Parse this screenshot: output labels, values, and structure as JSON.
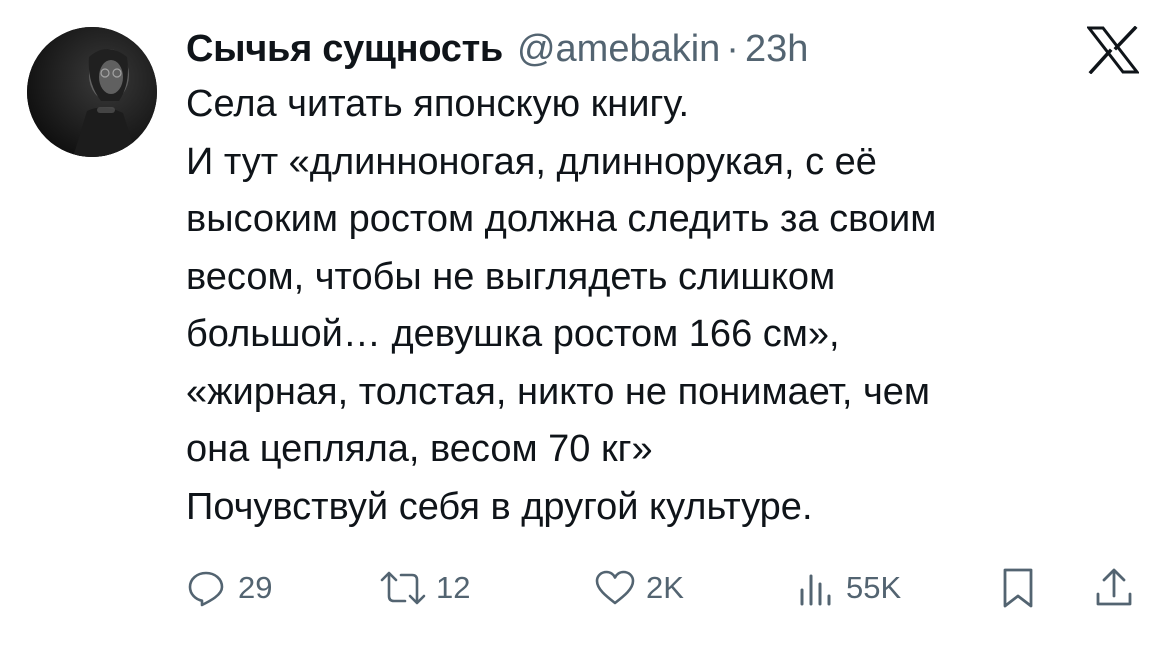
{
  "author": {
    "display_name": "Сычья сущность",
    "handle": "@amebakin",
    "separator": "·",
    "time": "23h",
    "avatar_icon": "avatar-photo"
  },
  "platform_icon": "x-logo-icon",
  "tweet": {
    "lines": [
      "Села читать японскую книгу.",
      "И тут «длинноногая, длиннорукая, с её",
      "высоким ростом должна следить за своим",
      "весом, чтобы не выглядеть слишком",
      "большой… девушка ростом 166 см»,",
      "«жирная, толстая, никто не понимает, чем",
      "она цепляла, весом 70 кг»",
      "Почувствуй себя в другой культуре."
    ]
  },
  "actions": {
    "reply": {
      "icon": "reply-icon",
      "count": "29"
    },
    "retweet": {
      "icon": "retweet-icon",
      "count": "12"
    },
    "like": {
      "icon": "heart-icon",
      "count": "2K"
    },
    "views": {
      "icon": "views-chart-icon",
      "count": "55K"
    },
    "bookmark": {
      "icon": "bookmark-icon"
    },
    "share": {
      "icon": "share-icon"
    }
  },
  "colors": {
    "text": "#0f1419",
    "secondary": "#536471",
    "background": "#ffffff"
  }
}
